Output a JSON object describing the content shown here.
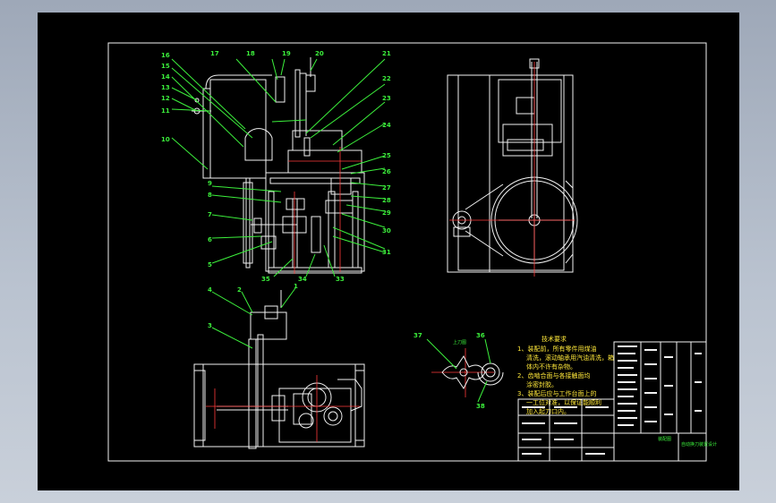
{
  "callouts_left_top": [
    "16",
    "15",
    "14",
    "13",
    "12",
    "11",
    "10",
    "17",
    "18",
    "19",
    "20",
    "21",
    "22",
    "23",
    "24",
    "25",
    "26",
    "27",
    "28",
    "29",
    "30",
    "31",
    "9",
    "8",
    "7",
    "6",
    "5",
    "35",
    "33",
    "34"
  ],
  "callouts_bottom": [
    "4",
    "2",
    "1",
    "3"
  ],
  "callouts_part": [
    "37",
    "36",
    "38"
  ],
  "part_label": "上刀图",
  "tech_title": "技术要求",
  "tech_lines": [
    "1、装配前，所有零件用煤油",
    "清洗，滚动轴承用汽油清洗，箱",
    "体内不许有杂物。",
    "2、齿啮合面与各接触面均",
    "涂密封胶。",
    "3、装配后应与工作台面上的",
    "一工位对准，以保证能顺利",
    "加入起刀口内。"
  ],
  "title_block": {
    "name": "装配图",
    "drawing_no": "自动换刀装置设计"
  },
  "colors": {
    "frame": "#f2f2f2",
    "lines": "#3cf03c",
    "center": "#ff3a3a",
    "notes": "#ffe83a"
  }
}
